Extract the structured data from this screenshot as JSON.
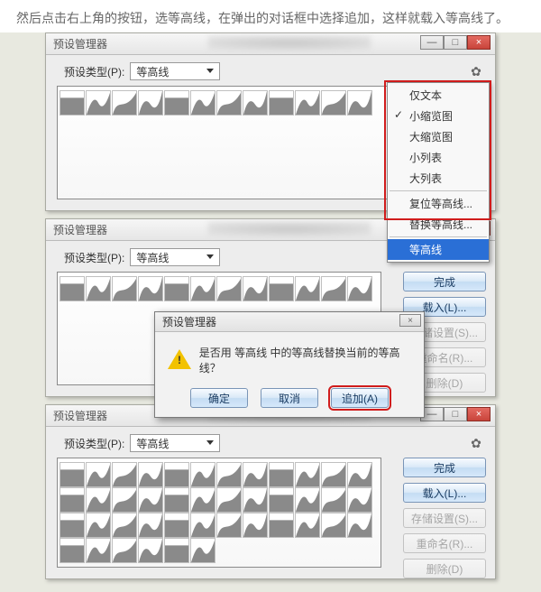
{
  "intro": "然后点击右上角的按钮，选等高线，在弹出的对话框中选择追加，这样就载入等高线了。",
  "common": {
    "window_title": "预设管理器",
    "preset_type_label": "预设类型(P):",
    "preset_type_value": "等高线",
    "btn_min": "—",
    "btn_max": "□",
    "btn_close": "×"
  },
  "menu": {
    "items": [
      {
        "label": "仅文本",
        "check": false
      },
      {
        "label": "小缩览图",
        "check": true
      },
      {
        "label": "大缩览图",
        "check": false
      },
      {
        "label": "小列表",
        "check": false
      },
      {
        "label": "大列表",
        "check": false
      }
    ],
    "section2": [
      {
        "label": "复位等高线..."
      },
      {
        "label": "替换等高线..."
      }
    ],
    "highlight": "等高线"
  },
  "panel": {
    "done": "完成",
    "load": "载入(L)...",
    "save": "存储设置(S)...",
    "rename": "重命名(R)...",
    "delete": "删除(D)"
  },
  "dialog": {
    "title": "预设管理器",
    "question": "是否用 等高线 中的等高线替换当前的等高线？",
    "ok": "确定",
    "cancel": "取消",
    "append": "追加(A)"
  }
}
